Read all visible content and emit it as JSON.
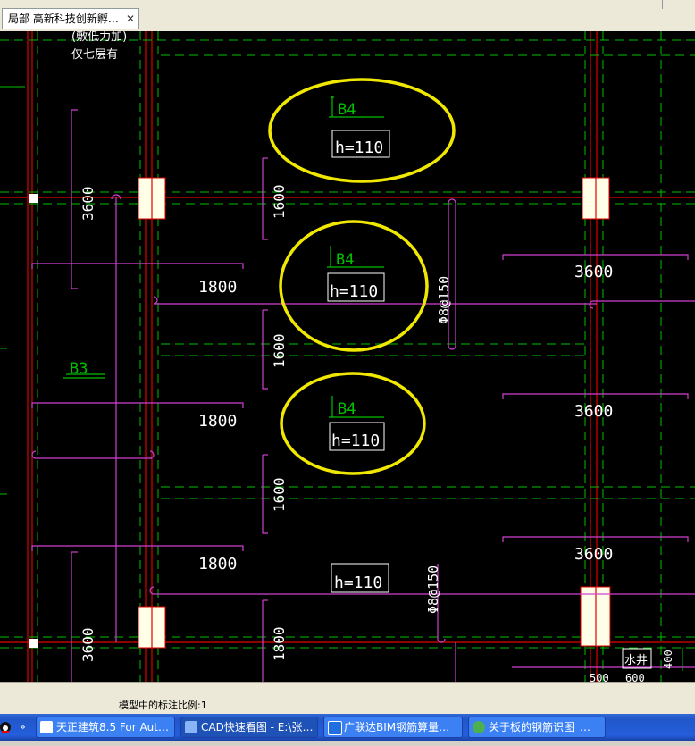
{
  "tab": {
    "label": "局部  高新科技创新孵…",
    "close": "✕"
  },
  "status": {
    "scale_text": "模型中的标注比例:1"
  },
  "drawing": {
    "note_line1": "(敷低力加)",
    "note_line2": "仅七层有",
    "slab_labels": [
      "B4",
      "B4",
      "B4",
      "B3"
    ],
    "thickness_labels": [
      "h=110",
      "h=110",
      "h=110",
      "h=110"
    ],
    "dims_1800": [
      "1800",
      "1800",
      "1800"
    ],
    "dims_1600": [
      "1600",
      "1600",
      "1600",
      "1800"
    ],
    "dims_3600_h": [
      "3600",
      "3600",
      "3600"
    ],
    "dims_3600_v": [
      "3600",
      "3600"
    ],
    "rebar_labels": [
      "Φ8@150",
      "Φ8@150"
    ],
    "water_well": "水井",
    "bottom_dims": [
      "500",
      "600"
    ],
    "right_dim": "400"
  },
  "taskbar": {
    "items": [
      {
        "label": "天正建筑8.5 For Aut…",
        "icon": "tangent-app-icon"
      },
      {
        "label": "CAD快速看图 - E:\\张…",
        "icon": "cad-viewer-icon"
      },
      {
        "label": "广联达BIM钢筋算量…",
        "icon": "glodon-icon"
      },
      {
        "label": "关于板的钢筋识图_…",
        "icon": "browser-icon"
      }
    ]
  },
  "colors": {
    "highlight": "#f0e800",
    "rebar": "#d040d0",
    "grid": "#00c000",
    "wall": "#e00000",
    "text": "#ffffff"
  }
}
